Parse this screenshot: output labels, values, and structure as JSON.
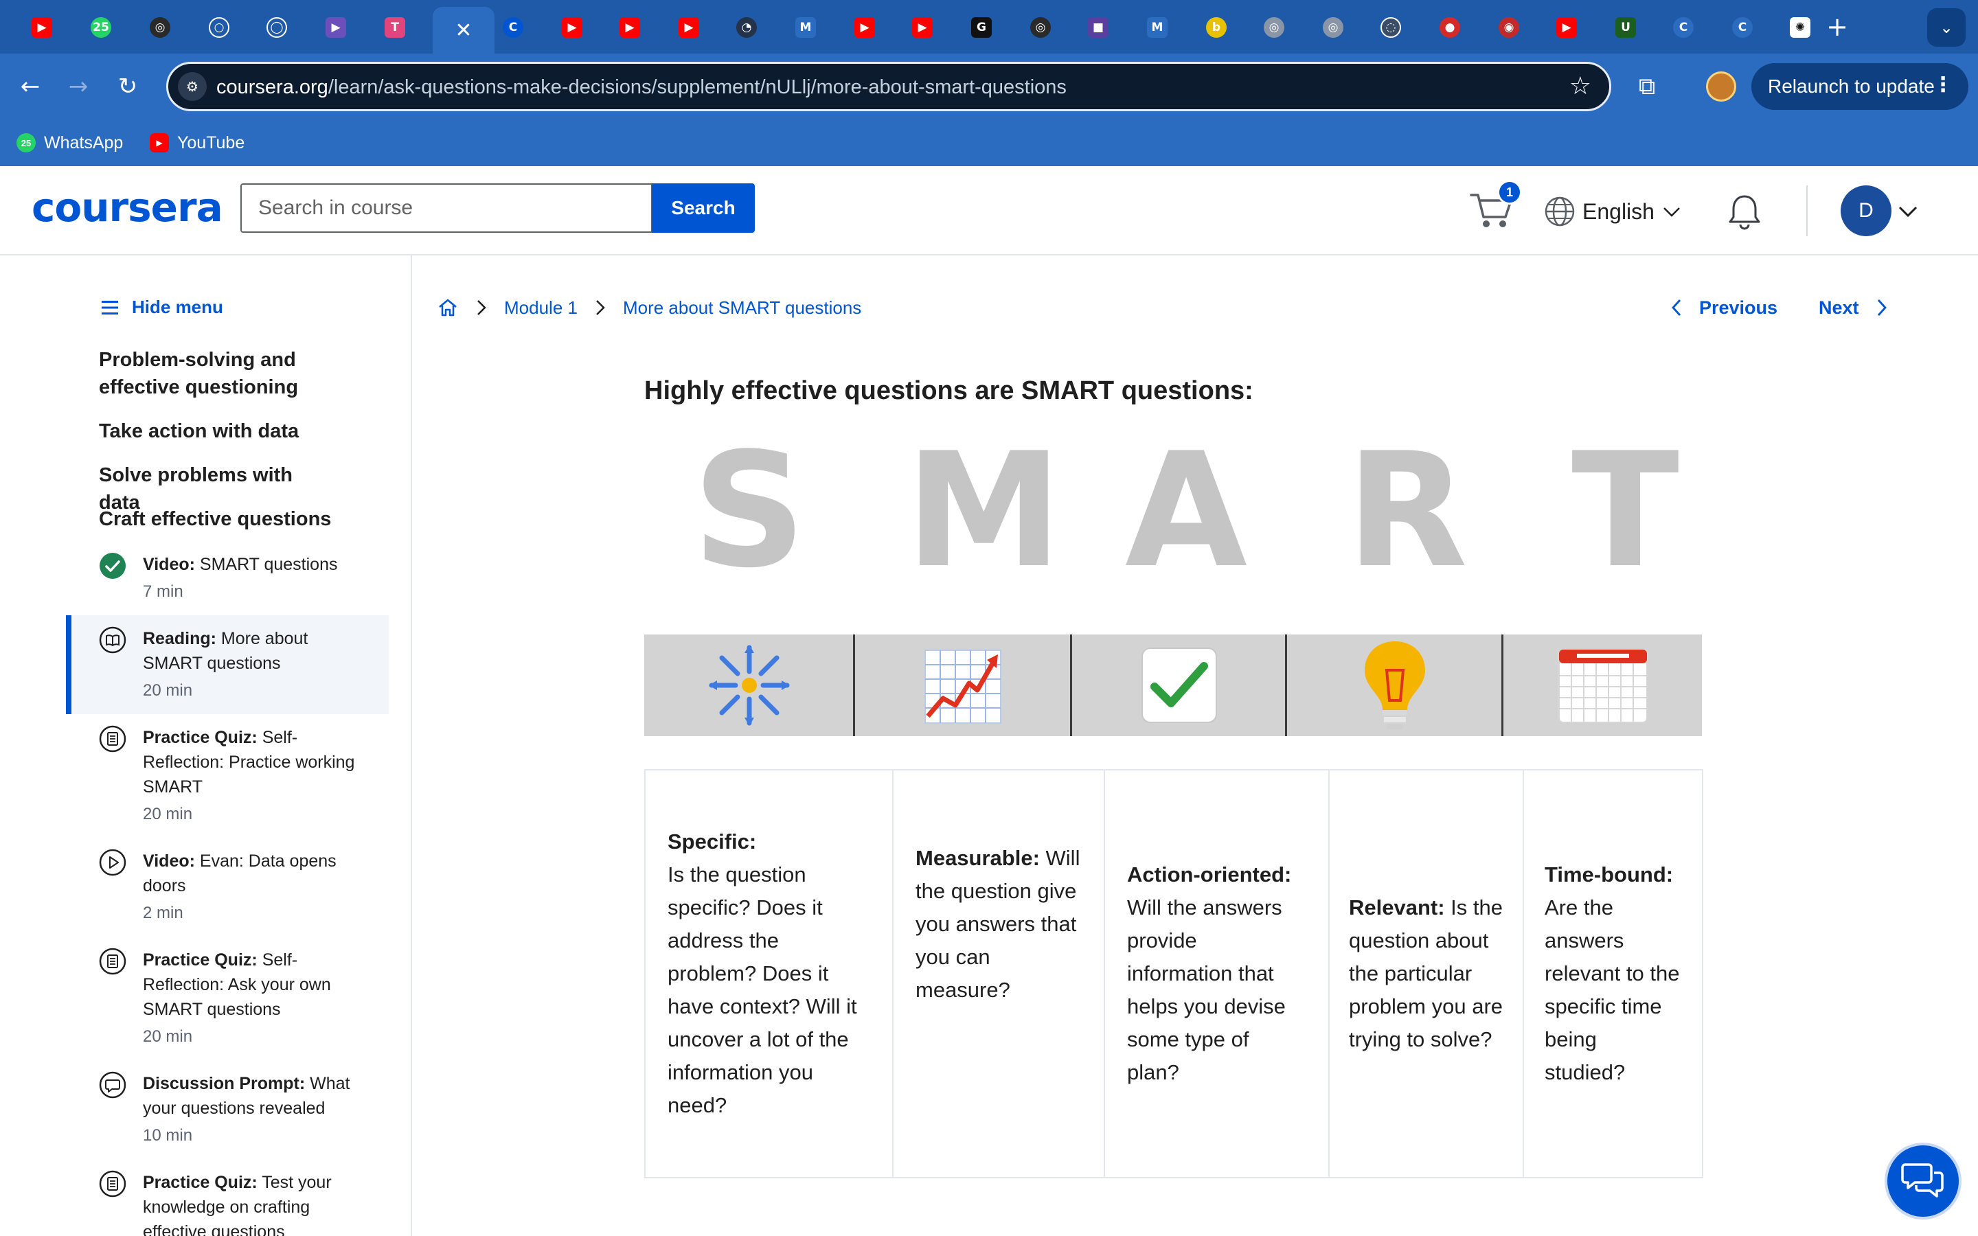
{
  "browser": {
    "tabs": [
      {
        "icon": "youtube-icon",
        "color": "#ff0000",
        "glyph": "▶"
      },
      {
        "icon": "whatsapp-icon",
        "color": "#25d366",
        "glyph": "25"
      },
      {
        "icon": "spiral-icon",
        "color": "#2a2a2a",
        "glyph": "◎"
      },
      {
        "icon": "circle-outline-icon",
        "color": "#1f5aa8",
        "glyph": "○"
      },
      {
        "icon": "github-icon",
        "color": "#1f5aa8",
        "glyph": "◯"
      },
      {
        "icon": "play-store-icon",
        "color": "#6b4fbb",
        "glyph": "▶"
      },
      {
        "icon": "t-badge-icon",
        "color": "#e0457b",
        "glyph": "T"
      },
      {
        "icon": "close-icon",
        "color": "transparent",
        "glyph": "✕"
      },
      {
        "icon": "coursera-icon",
        "color": "#0056d2",
        "glyph": "C"
      },
      {
        "icon": "youtube-icon",
        "color": "#ff0000",
        "glyph": "▶"
      },
      {
        "icon": "youtube-icon",
        "color": "#ff0000",
        "glyph": "▶"
      },
      {
        "icon": "youtube-icon",
        "color": "#ff0000",
        "glyph": "▶"
      },
      {
        "icon": "compass-icon",
        "color": "#24324a",
        "glyph": "◔"
      },
      {
        "icon": "m-logo-icon",
        "color": "#2b6bc0",
        "glyph": "M"
      },
      {
        "icon": "youtube-icon",
        "color": "#ff0000",
        "glyph": "▶"
      },
      {
        "icon": "youtube-icon",
        "color": "#ff0000",
        "glyph": "▶"
      },
      {
        "icon": "gt-logo-icon",
        "color": "#111111",
        "glyph": "G"
      },
      {
        "icon": "spiral-icon",
        "color": "#2a2a2a",
        "glyph": "◎"
      },
      {
        "icon": "video-camera-icon",
        "color": "#5a3fa0",
        "glyph": "■"
      },
      {
        "icon": "m-logo-icon",
        "color": "#2b6bc0",
        "glyph": "M"
      },
      {
        "icon": "b-logo-icon",
        "color": "#e6c200",
        "glyph": "b"
      },
      {
        "icon": "target-icon",
        "color": "#8a96a8",
        "glyph": "◎"
      },
      {
        "icon": "target-icon",
        "color": "#8a96a8",
        "glyph": "◎"
      },
      {
        "icon": "circle-outline-icon",
        "color": "#3b4c66",
        "glyph": "◌"
      },
      {
        "icon": "ball-icon",
        "color": "#d42a2a",
        "glyph": "●"
      },
      {
        "icon": "record-icon",
        "color": "#c22a2a",
        "glyph": "◉"
      },
      {
        "icon": "youtube-icon",
        "color": "#ff0000",
        "glyph": "▶"
      },
      {
        "icon": "myunt-icon",
        "color": "#1b5e20",
        "glyph": "U"
      },
      {
        "icon": "coursera-icon",
        "color": "#2b6bc0",
        "glyph": "C"
      },
      {
        "icon": "coursera-icon",
        "color": "#2b6bc0",
        "glyph": "C"
      },
      {
        "icon": "openai-icon",
        "color": "#ffffff",
        "glyph": "✺"
      }
    ],
    "url_domain": "coursera.org",
    "url_path": "/learn/ask-questions-make-decisions/supplement/nULlj/more-about-smart-questions",
    "relaunch_label": "Relaunch to update",
    "bookmarks": [
      {
        "label": "WhatsApp",
        "icon": "whatsapp-icon",
        "color": "#25d366"
      },
      {
        "label": "YouTube",
        "icon": "youtube-icon",
        "color": "#ff0000"
      }
    ],
    "whatsapp_badge": "25"
  },
  "header": {
    "logo": "coursera",
    "search_placeholder": "Search in course",
    "search_button": "Search",
    "cart_count": "1",
    "language": "English",
    "avatar_initial": "D"
  },
  "sidebar": {
    "hide_menu": "Hide menu",
    "sections": [
      "Problem-solving and effective questioning",
      "Take action with data",
      "Solve problems with data",
      "Craft effective questions"
    ],
    "items": [
      {
        "type": "Video:",
        "title": "SMART questions",
        "duration": "7 min",
        "icon": "completed-check-icon"
      },
      {
        "type": "Reading:",
        "title": "More about SMART questions",
        "duration": "20 min",
        "icon": "book-icon"
      },
      {
        "type": "Practice Quiz:",
        "title": "Self-Reflection: Practice working SMART",
        "duration": "20 min",
        "icon": "quiz-icon"
      },
      {
        "type": "Video:",
        "title": "Evan: Data opens doors",
        "duration": "2 min",
        "icon": "play-circle-icon"
      },
      {
        "type": "Practice Quiz:",
        "title": "Self-Reflection: Ask your own SMART questions",
        "duration": "20 min",
        "icon": "quiz-icon"
      },
      {
        "type": "Discussion Prompt:",
        "title": "What your questions revealed",
        "duration": "10 min",
        "icon": "discussion-icon"
      },
      {
        "type": "Practice Quiz:",
        "title": "Test your knowledge on crafting effective questions",
        "duration": "",
        "icon": "quiz-icon"
      }
    ]
  },
  "breadcrumb": {
    "module": "Module 1",
    "current": "More about SMART questions"
  },
  "pager": {
    "previous": "Previous",
    "next": "Next"
  },
  "content": {
    "heading": "Highly effective questions are SMART questions:",
    "letters": [
      "S",
      "M",
      "A",
      "R",
      "T"
    ],
    "strip_icons": [
      "focus-burst-icon",
      "rising-chart-icon",
      "checkmark-box-icon",
      "lightbulb-icon",
      "calendar-icon"
    ],
    "table": [
      {
        "term": "Specific:",
        "desc": "Is the question specific? Does it address the problem? Does it have context? Will it uncover a lot of the information you need?",
        "break_after_term": true
      },
      {
        "term": "Measurable:",
        "desc": "Will the question give you answers that you can measure?",
        "break_after_term": false
      },
      {
        "term": "Action-oriented:",
        "desc": "Will the answers provide information that helps you devise some type of plan?",
        "break_after_term": true
      },
      {
        "term": "Relevant:",
        "desc": "Is the question about the particular problem you are trying to solve?",
        "break_after_term": false
      },
      {
        "term": "Time-bound:",
        "desc": "Are the answers relevant to the specific time being studied?",
        "break_after_term": true
      }
    ]
  },
  "colors": {
    "brand": "#0056d2",
    "browser_frame": "#1f5aa8",
    "letter_gray": "#c5c5c5",
    "strip_gray": "#d3d3d3",
    "complete_green": "#1f8354"
  }
}
